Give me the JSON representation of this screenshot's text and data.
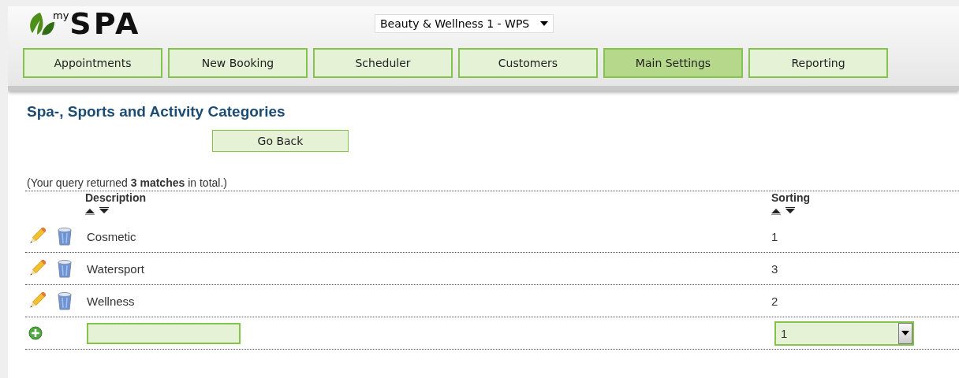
{
  "header": {
    "logo": {
      "superscript": "my",
      "wordmark": "SPA"
    },
    "location_select": {
      "value": "Beauty & Wellness 1 - WPS"
    }
  },
  "nav": [
    {
      "label": "Appointments",
      "selected": false
    },
    {
      "label": "New Booking",
      "selected": false
    },
    {
      "label": "Scheduler",
      "selected": false
    },
    {
      "label": "Customers",
      "selected": false
    },
    {
      "label": "Main Settings",
      "selected": true
    },
    {
      "label": "Reporting",
      "selected": false
    }
  ],
  "page_title": "Spa-, Sports and Activity Categories",
  "back_button": "Go Back",
  "result_summary": "(Your query returned **3 matches** in total.)",
  "table": {
    "columns": [
      "Description",
      "Sorting"
    ],
    "rows": [
      {
        "description": "Cosmetic",
        "sorting": "1"
      },
      {
        "description": "Watersport",
        "sorting": "3"
      },
      {
        "description": "Wellness",
        "sorting": "2"
      }
    ],
    "new_row": {
      "sorting_value": "1"
    }
  }
}
